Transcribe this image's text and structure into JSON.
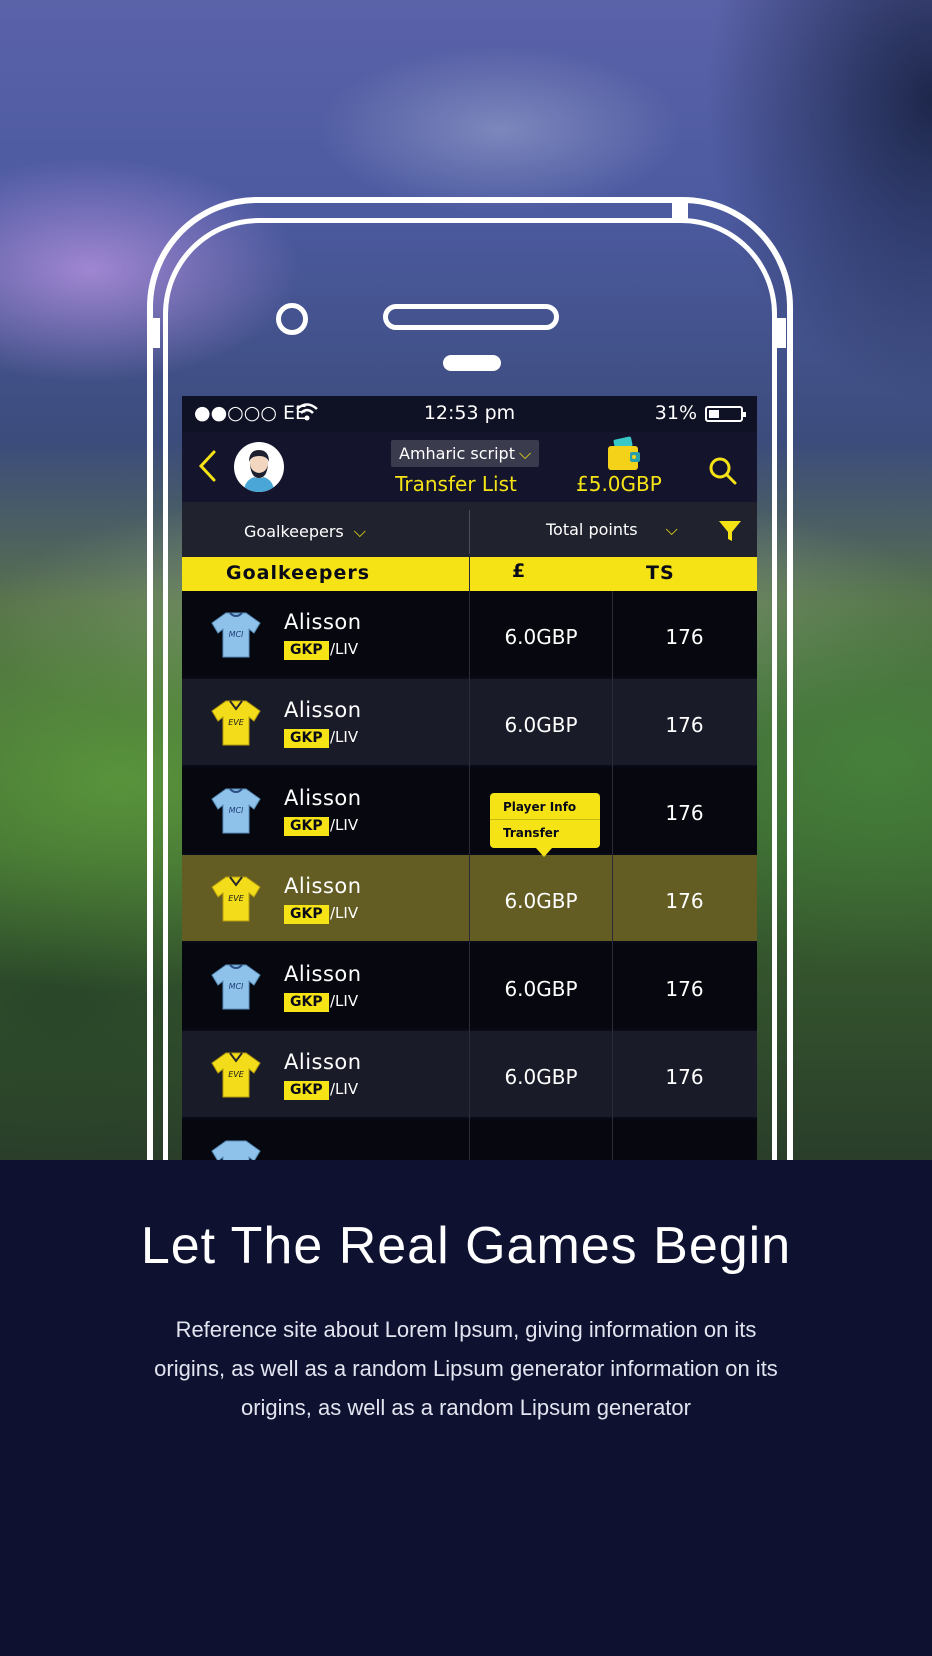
{
  "colors": {
    "accent": "#f5e316",
    "screen_bg": "#0a0b18",
    "page_bg": "#0e1230",
    "highlight_row": "#635c23"
  },
  "status_bar": {
    "carrier": "EE",
    "time": "12:53 pm",
    "battery": "31%"
  },
  "app_bar": {
    "language": "Amharic script",
    "title": "Transfer List",
    "balance": "£5.0GBP",
    "icons": [
      "back-icon",
      "avatar",
      "wallet-icon",
      "search-icon"
    ]
  },
  "filters": {
    "position": "Goalkeepers",
    "sort": "Total points"
  },
  "table": {
    "headers": {
      "name": "Goalkeepers",
      "price": "£",
      "ts": "TS"
    },
    "rows": [
      {
        "name": "Alisson",
        "position": "GKP",
        "team": "/LIV",
        "price": "6.0GBP",
        "ts": "176",
        "jersey": "MCI"
      },
      {
        "name": "Alisson",
        "position": "GKP",
        "team": "/LIV",
        "price": "6.0GBP",
        "ts": "176",
        "jersey": "EVE"
      },
      {
        "name": "Alisson",
        "position": "GKP",
        "team": "/LIV",
        "price": "",
        "ts": "176",
        "jersey": "MCI"
      },
      {
        "name": "Alisson",
        "position": "GKP",
        "team": "/LIV",
        "price": "6.0GBP",
        "ts": "176",
        "jersey": "EVE"
      },
      {
        "name": "Alisson",
        "position": "GKP",
        "team": "/LIV",
        "price": "6.0GBP",
        "ts": "176",
        "jersey": "MCI"
      },
      {
        "name": "Alisson",
        "position": "GKP",
        "team": "/LIV",
        "price": "6.0GBP",
        "ts": "176",
        "jersey": "EVE"
      }
    ]
  },
  "popup": {
    "player_info": "Player Info",
    "transfer": "Transfer"
  },
  "promo": {
    "headline": "Let The Real Games Begin",
    "description": "Reference site about Lorem Ipsum, giving information on its origins, as well as a random Lipsum generator information on its origins, as well as a random Lipsum generator"
  }
}
